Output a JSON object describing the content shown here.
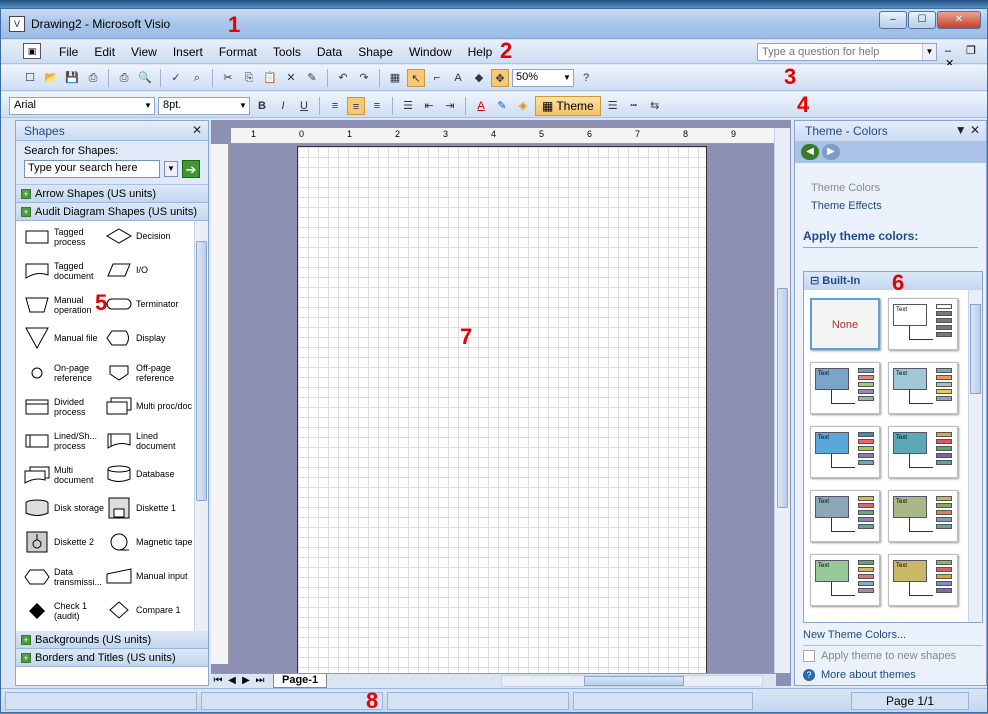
{
  "window": {
    "title": "Drawing2 - Microsoft Visio",
    "app_icon": "visio-icon",
    "min": "‒",
    "max": "☐",
    "close": "✕"
  },
  "menu": {
    "items": [
      "File",
      "Edit",
      "View",
      "Insert",
      "Format",
      "Tools",
      "Data",
      "Shape",
      "Window",
      "Help"
    ],
    "help_placeholder": "Type a question for help"
  },
  "toolbar": {
    "zoom": "50%"
  },
  "format": {
    "font": "Arial",
    "size": "8pt.",
    "theme_label": "Theme"
  },
  "shapes_panel": {
    "title": "Shapes",
    "search_label": "Search for Shapes:",
    "search_placeholder": "Type your search here",
    "stencils_top": [
      "Arrow Shapes (US units)",
      "Audit Diagram Shapes (US units)"
    ],
    "stencils_bottom": [
      "Backgrounds (US units)",
      "Borders and Titles (US units)"
    ],
    "items": [
      [
        "Tagged process",
        "Decision"
      ],
      [
        "Tagged document",
        "I/O"
      ],
      [
        "Manual operation",
        "Terminator"
      ],
      [
        "Manual file",
        "Display"
      ],
      [
        "On-page reference",
        "Off-page reference"
      ],
      [
        "Divided process",
        "Multi proc/doc"
      ],
      [
        "Lined/Sh... process",
        "Lined document"
      ],
      [
        "Multi document",
        "Database"
      ],
      [
        "Disk storage",
        "Diskette 1"
      ],
      [
        "Diskette 2",
        "Magnetic tape"
      ],
      [
        "Data transmissi...",
        "Manual input"
      ],
      [
        "Check 1 (audit)",
        "Compare 1"
      ]
    ]
  },
  "canvas": {
    "page_tab": "Page-1",
    "ruler_labels": [
      "1",
      "0",
      "1",
      "2",
      "3",
      "4",
      "5",
      "6",
      "7",
      "8",
      "9"
    ]
  },
  "theme_panel": {
    "title": "Theme - Colors",
    "link_colors": "Theme Colors",
    "link_effects": "Theme Effects",
    "apply_heading": "Apply theme colors:",
    "builtin": "Built-In",
    "none_label": "None",
    "thumb_text": "Text",
    "new_colors": "New Theme Colors...",
    "apply_new": "Apply theme to new shapes",
    "more": "More about themes"
  },
  "status": {
    "page": "Page 1/1"
  },
  "annotations": [
    "1",
    "2",
    "3",
    "4",
    "5",
    "6",
    "7",
    "8"
  ],
  "colors": {
    "accent": "#1f4a86",
    "annotation": "#e80000"
  }
}
